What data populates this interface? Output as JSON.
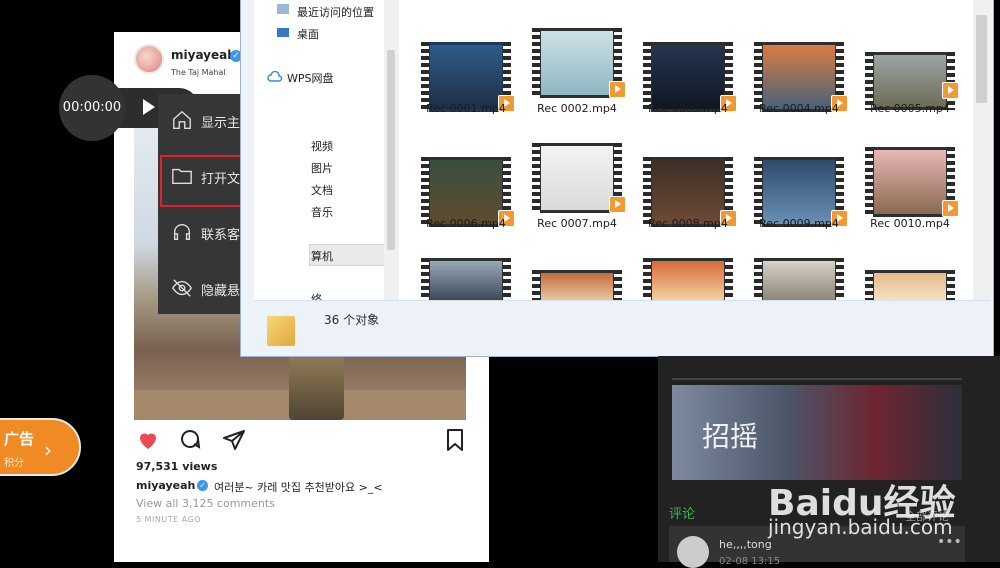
{
  "post": {
    "username": "miyayeah",
    "location": "The Taj Mahal",
    "views": "97,531 views",
    "caption_user": "miyayeah",
    "caption_text": "여러분~ 카레 맛집 추천받아요 >_<",
    "comments_link": "View all 3,125 comments",
    "time": "5 MINUTE AGO"
  },
  "ad": {
    "title": "广告",
    "subtitle": "积分"
  },
  "timer": {
    "time": "00:00:00"
  },
  "menu": {
    "items": [
      {
        "label": "显示主界面",
        "icon": "home-icon"
      },
      {
        "label": "打开文件夹",
        "icon": "folder-icon"
      },
      {
        "label": "联系客服",
        "icon": "headset-icon"
      },
      {
        "label": "隐藏悬浮框",
        "icon": "eye-off-icon"
      }
    ],
    "highlight_color": "#e0202b"
  },
  "explorer": {
    "nav": {
      "recent": "最近访问的位置",
      "desktop": "桌面",
      "wps": "WPS网盘",
      "videos": "视频",
      "pictures": "图片",
      "documents": "文档",
      "music": "音乐",
      "computer": "算机",
      "network": "络"
    },
    "files": [
      "Rec 0001.mp4",
      "Rec 0002.mp4",
      "Rec 0003.mp4",
      "Rec 0004.mp4",
      "Rec 0005.mp4",
      "Rec 0006.mp4",
      "Rec 0007.mp4",
      "Rec 0008.mp4",
      "Rec 0009.mp4",
      "Rec 0010.mp4"
    ],
    "status": "36 个对象"
  },
  "right_panel": {
    "banner_title": "招摇",
    "comments_heading": "评论",
    "comments_all": "全部评论",
    "comment_user": "he,,,,tong",
    "comment_time": "02-08 13:15"
  },
  "watermark": {
    "brand": "Baidu经验",
    "url": "jingyan.baidu.com"
  }
}
